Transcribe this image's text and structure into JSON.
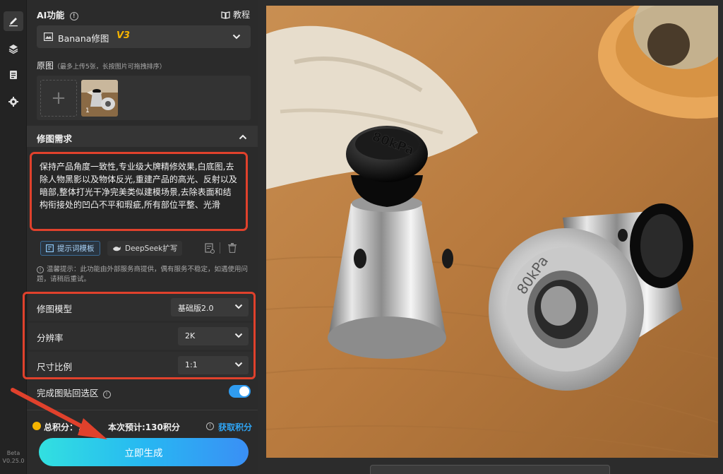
{
  "rail": {
    "version_line1": "Beta",
    "version_line2": "V0.25.0"
  },
  "ai_section": {
    "title": "AI功能",
    "tutorial_label": "教程",
    "model_name": "Banana修图",
    "model_version": "V3"
  },
  "original": {
    "title": "原图",
    "hint": "（最多上传5张，长按图片可拖拽排序）",
    "thumb_index": "1"
  },
  "requirement": {
    "title": "修图需求",
    "text": "保持产品角度一致性,专业级大牌精修效果,白底图,去除人物黑影以及物体反光,重建产品的高光、反射以及暗部,整体打光干净完美类似建模场景,去除表面和结构衔接处的凹凸不平和瑕疵,所有部位平整、光滑",
    "template_label": "提示词模板",
    "deepseek_label": "DeepSeek扩写"
  },
  "notice": {
    "text": "温馨提示：此功能由外部服务商提供，偶有服务不稳定，如遇使用问题，请稍后重试。"
  },
  "settings": {
    "model_label": "修图模型",
    "model_value": "基础版2.0",
    "resolution_label": "分辨率",
    "resolution_value": "2K",
    "ratio_label": "尺寸比例",
    "ratio_value": "1:1"
  },
  "paste_back": {
    "label": "完成图贴回选区",
    "enabled": true
  },
  "points": {
    "total_label": "总积分：7",
    "estimate_label": "本次预计:130积分",
    "get_points_label": "获取积分"
  },
  "generate_label": "立即生成",
  "photo": {
    "cap_left_text": "80kPa",
    "cap_right_text": "80kPa"
  },
  "colors": {
    "accent_red": "#e0412c",
    "accent_blue": "#2f9cf0",
    "gold": "#f5b400"
  }
}
